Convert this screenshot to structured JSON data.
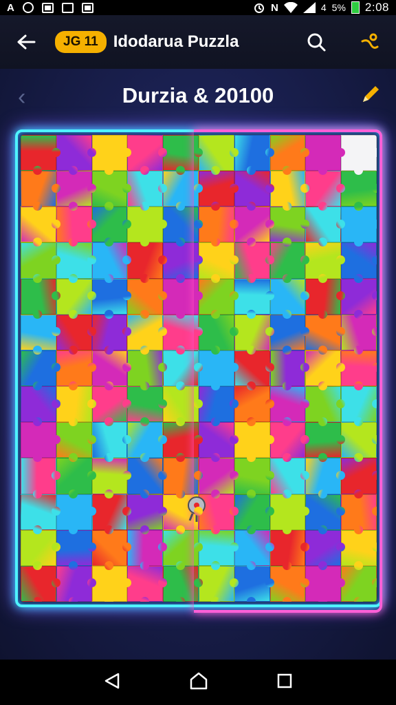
{
  "status_bar": {
    "time": "2:08",
    "signal_text": "4",
    "battery_text": "5%",
    "battery_color": "#2ecc40",
    "icons": [
      "a-notification-icon",
      "circle-notification-icon",
      "image-notification-icon",
      "nfc-notification-icon",
      "photo-notification-icon",
      "alarm-icon",
      "nfc-icon",
      "wifi-icon",
      "signal-icon",
      "battery-icon"
    ]
  },
  "app_bar": {
    "level_badge": "JG 11",
    "title": "Idodarua Puzzla",
    "badge_color": "#f5b000",
    "icons": [
      "back-arrow-icon",
      "search-icon",
      "settings-icon"
    ]
  },
  "puzzle": {
    "title": "Durzia & 20100",
    "icons": [
      "chevron-left-icon",
      "pencil-icon"
    ],
    "columns": 10,
    "rows": 13,
    "frame_colors": [
      "#4ff3ff",
      "#ff5fd7"
    ],
    "palette": [
      "#e8262c",
      "#ff7a1a",
      "#ffd21a",
      "#7ed321",
      "#2ebd4a",
      "#29b6f6",
      "#1e6fe0",
      "#8e2bd8",
      "#d42ab8",
      "#ff3d8b",
      "#3de0e8",
      "#b4e61e"
    ],
    "empty_piece_index": 9
  },
  "controls": {
    "close_icon": "close-icon"
  },
  "nav_bar": {
    "icons": [
      "nav-back-icon",
      "nav-home-icon",
      "nav-recents-icon"
    ]
  }
}
